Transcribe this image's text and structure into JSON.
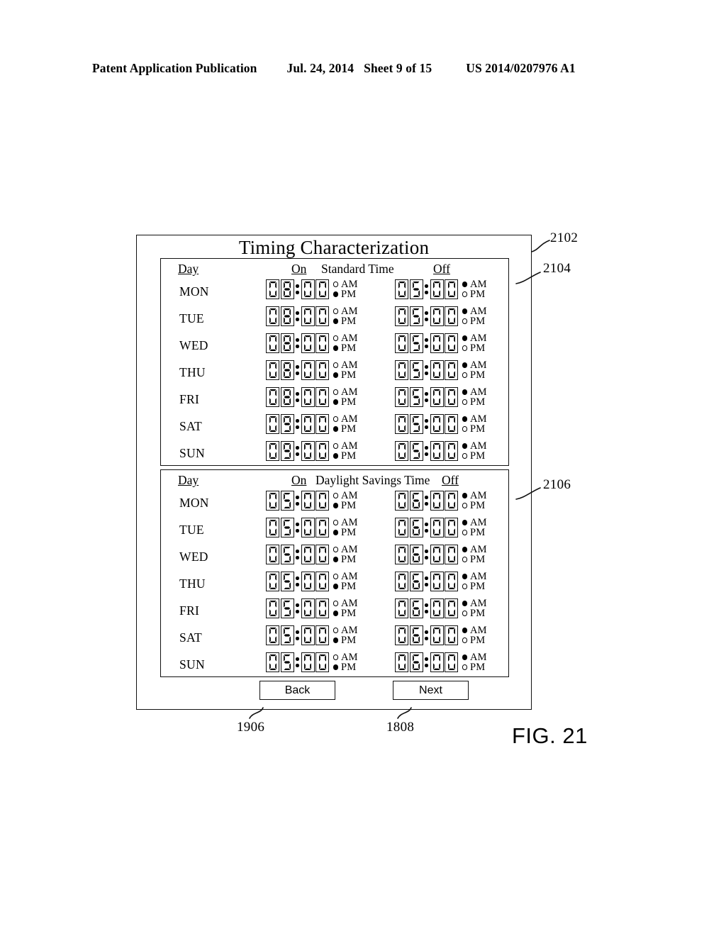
{
  "header": {
    "publication": "Patent Application Publication",
    "date": "Jul. 24, 2014",
    "sheet": "Sheet 9 of 15",
    "patent_number": "US 2014/0207976 A1"
  },
  "figure": {
    "label": "FIG. 21",
    "title": "Timing Characterization",
    "callouts": {
      "frame": "2102",
      "standard_panel": "2104",
      "dst_panel": "2106",
      "back_button": "1906",
      "next_button": "1808"
    }
  },
  "columns": {
    "day": "Day",
    "on": "On",
    "off": "Off",
    "am": "AM",
    "pm": "PM"
  },
  "panels": [
    {
      "name": "standard_time",
      "title": "Standard Time",
      "rows": [
        {
          "day": "MON",
          "on": {
            "digits": "0800",
            "meridiem": "PM"
          },
          "off": {
            "digits": "0500",
            "meridiem": "AM"
          }
        },
        {
          "day": "TUE",
          "on": {
            "digits": "0800",
            "meridiem": "PM"
          },
          "off": {
            "digits": "0500",
            "meridiem": "AM"
          }
        },
        {
          "day": "WED",
          "on": {
            "digits": "0800",
            "meridiem": "PM"
          },
          "off": {
            "digits": "0500",
            "meridiem": "AM"
          }
        },
        {
          "day": "THU",
          "on": {
            "digits": "0800",
            "meridiem": "PM"
          },
          "off": {
            "digits": "0500",
            "meridiem": "AM"
          }
        },
        {
          "day": "FRI",
          "on": {
            "digits": "0800",
            "meridiem": "PM"
          },
          "off": {
            "digits": "0500",
            "meridiem": "AM"
          }
        },
        {
          "day": "SAT",
          "on": {
            "digits": "0900",
            "meridiem": "PM"
          },
          "off": {
            "digits": "0500",
            "meridiem": "AM"
          }
        },
        {
          "day": "SUN",
          "on": {
            "digits": "0900",
            "meridiem": "PM"
          },
          "off": {
            "digits": "0500",
            "meridiem": "AM"
          }
        }
      ]
    },
    {
      "name": "daylight_savings_time",
      "title": "Daylight Savings Time",
      "rows": [
        {
          "day": "MON",
          "on": {
            "digits": "0500",
            "meridiem": "PM"
          },
          "off": {
            "digits": "0600",
            "meridiem": "AM"
          }
        },
        {
          "day": "TUE",
          "on": {
            "digits": "0500",
            "meridiem": "PM"
          },
          "off": {
            "digits": "0600",
            "meridiem": "AM"
          }
        },
        {
          "day": "WED",
          "on": {
            "digits": "0500",
            "meridiem": "PM"
          },
          "off": {
            "digits": "0600",
            "meridiem": "AM"
          }
        },
        {
          "day": "THU",
          "on": {
            "digits": "0500",
            "meridiem": "PM"
          },
          "off": {
            "digits": "0600",
            "meridiem": "AM"
          }
        },
        {
          "day": "FRI",
          "on": {
            "digits": "0500",
            "meridiem": "PM"
          },
          "off": {
            "digits": "0600",
            "meridiem": "AM"
          }
        },
        {
          "day": "SAT",
          "on": {
            "digits": "0500",
            "meridiem": "PM"
          },
          "off": {
            "digits": "0600",
            "meridiem": "AM"
          }
        },
        {
          "day": "SUN",
          "on": {
            "digits": "0500",
            "meridiem": "PM"
          },
          "off": {
            "digits": "0600",
            "meridiem": "AM"
          }
        }
      ]
    }
  ],
  "buttons": {
    "back": "Back",
    "next": "Next"
  },
  "colors": {
    "ink": "#000000",
    "paper": "#ffffff"
  }
}
